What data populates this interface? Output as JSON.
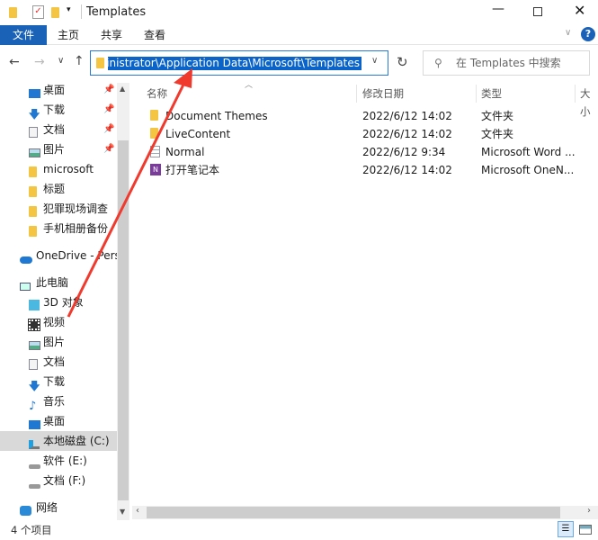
{
  "window": {
    "title": "Templates"
  },
  "ribbon": {
    "tabs": [
      "文件",
      "主页",
      "共享",
      "查看"
    ]
  },
  "address": {
    "path": "Administrator\\Application Data\\Microsoft\\Templates",
    "search_placeholder": "在 Templates 中搜索"
  },
  "sidebar": {
    "quick": [
      {
        "label": "桌面",
        "icon": "desktop-icon"
      },
      {
        "label": "下载",
        "icon": "download-icon"
      },
      {
        "label": "文档",
        "icon": "document-icon"
      },
      {
        "label": "图片",
        "icon": "picture-icon"
      },
      {
        "label": "microsoft",
        "icon": "folder-icon"
      },
      {
        "label": "标题",
        "icon": "folder-icon"
      },
      {
        "label": "犯罪现场调查",
        "icon": "folder-icon"
      },
      {
        "label": "手机相册备份",
        "icon": "folder-icon"
      }
    ],
    "onedrive": "OneDrive - Perso",
    "pc": "此电脑",
    "pc_items": [
      {
        "label": "3D 对象"
      },
      {
        "label": "视频"
      },
      {
        "label": "图片"
      },
      {
        "label": "文档"
      },
      {
        "label": "下载"
      },
      {
        "label": "音乐"
      },
      {
        "label": "桌面"
      },
      {
        "label": "本地磁盘 (C:)",
        "selected": true
      },
      {
        "label": "软件 (E:)"
      },
      {
        "label": "文档 (F:)"
      }
    ],
    "network": "网络"
  },
  "columns": [
    "名称",
    "修改日期",
    "类型",
    "大小"
  ],
  "files": [
    {
      "name": "Document Themes",
      "date": "2022/6/12 14:02",
      "type": "文件夹",
      "icon": "folder-icon"
    },
    {
      "name": "LiveContent",
      "date": "2022/6/12 14:02",
      "type": "文件夹",
      "icon": "folder-icon"
    },
    {
      "name": "Normal",
      "date": "2022/6/12 9:34",
      "type": "Microsoft Word ...",
      "icon": "word-template-icon"
    },
    {
      "name": "打开笔记本",
      "date": "2022/6/12 14:02",
      "type": "Microsoft OneN...",
      "icon": "onenote-icon"
    }
  ],
  "status": {
    "count": "4 个项目"
  },
  "colors": {
    "accent": "#1a62b8",
    "annotation_arrow": "#f03a2e"
  }
}
